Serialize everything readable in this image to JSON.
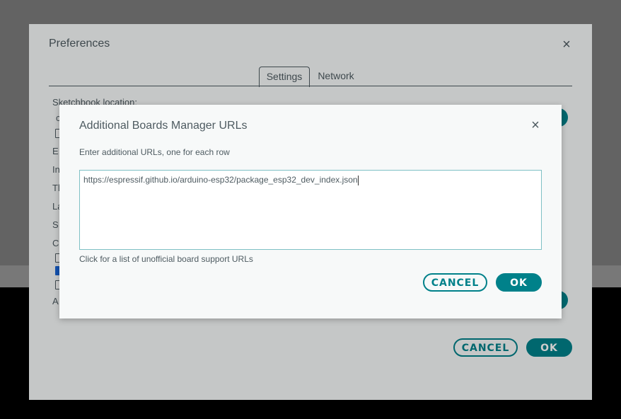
{
  "preferences": {
    "title": "Preferences",
    "close_icon": "×",
    "tabs": [
      {
        "label": "Settings",
        "active": true
      },
      {
        "label": "Network",
        "active": false
      }
    ],
    "sketchbook_label": "Sketchbook location:",
    "cancel_label": "CANCEL",
    "ok_label": "OK",
    "partial_glyphs": [
      "c",
      "E",
      "In",
      "Th",
      "La",
      "S",
      "C",
      "A"
    ]
  },
  "boards_dialog": {
    "title": "Additional Boards Manager URLs",
    "close_icon": "×",
    "instruction": "Enter additional URLs, one for each row",
    "urls_value": "https://espressif.github.io/arduino-esp32/package_esp32_dev_index.json",
    "help_link": "Click for a list of unofficial board support URLs",
    "cancel_label": "CANCEL",
    "ok_label": "OK"
  },
  "colors": {
    "accent": "#00818a",
    "text": "#4e5b61",
    "dialog_bg": "#f7f9f9",
    "checkbox_checked": "#1a66d9"
  }
}
